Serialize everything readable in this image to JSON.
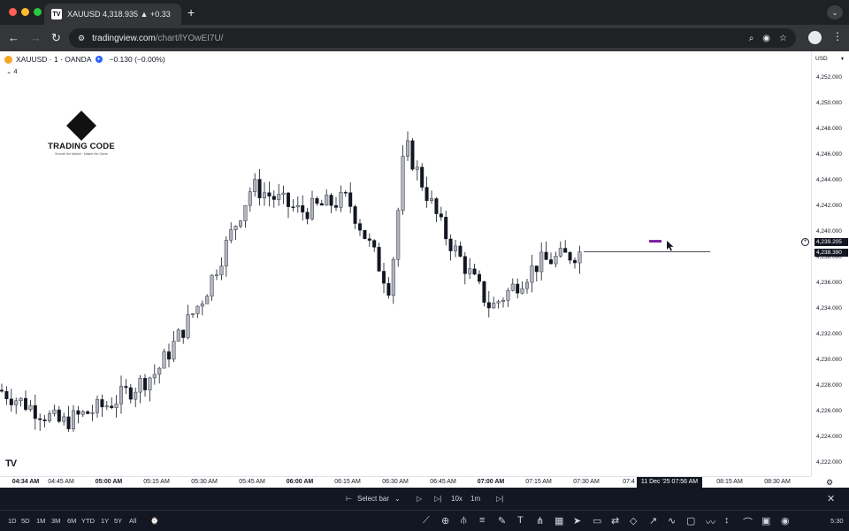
{
  "browser": {
    "tab_title": "XAUUSD 4,318.935 ▲ +0.33",
    "tab_favicon": "tradingview-favicon-icon",
    "url_prefix": "tradingview.com",
    "url_path": "/chart/lYOwEI7U/"
  },
  "chart": {
    "symbol_line": "XAUUSD · 1 · OANDA",
    "change": "−0.130 (−0.00%)",
    "indicator_count": "4",
    "logo_name": "TRADING CODE",
    "logo_tagline": "Smooth the Market · Master the Game",
    "currency": "USD",
    "price_ticks": [
      "4,252.000",
      "4,250.000",
      "4,248.000",
      "4,246.000",
      "4,244.000",
      "4,242.000",
      "4,240.000",
      "4,238.000",
      "4,236.000",
      "4,234.000",
      "4,232.000",
      "4,230.000",
      "4,228.000",
      "4,226.000",
      "4,224.000",
      "4,222.000"
    ],
    "crosshair_price": "4,239.205",
    "last_price": "4,238.390",
    "time_ticks": [
      {
        "label": "04:34 AM",
        "bold": true
      },
      {
        "label": "04:45 AM",
        "bold": false
      },
      {
        "label": "05:00 AM",
        "bold": true
      },
      {
        "label": "05:15 AM",
        "bold": false
      },
      {
        "label": "05:30 AM",
        "bold": false
      },
      {
        "label": "05:45 AM",
        "bold": false
      },
      {
        "label": "06:00 AM",
        "bold": true
      },
      {
        "label": "06:15 AM",
        "bold": false
      },
      {
        "label": "06:30 AM",
        "bold": false
      },
      {
        "label": "06:45 AM",
        "bold": false
      },
      {
        "label": "07:00 AM",
        "bold": true
      },
      {
        "label": "07:15 AM",
        "bold": false
      },
      {
        "label": "07:30 AM",
        "bold": false
      },
      {
        "label": "07:4",
        "bold": false
      },
      {
        "label": "08:15 AM",
        "bold": false
      },
      {
        "label": "08:30 AM",
        "bold": false
      }
    ],
    "crosshair_time": "11 Dec '25   07:56 AM",
    "colors": {
      "up": "#b2b5be",
      "down": "#131722",
      "accent": "#2962ff",
      "highlight": "#7b1fa2"
    }
  },
  "chart_data": {
    "type": "candlestick",
    "symbol": "XAUUSD",
    "interval": "1",
    "exchange": "OANDA",
    "ylim": [
      4221,
      4253
    ],
    "close_path": [
      {
        "x": "04:34 AM",
        "y": 4227.6
      },
      {
        "x": "04:45 AM",
        "y": 4225.0
      },
      {
        "x": "05:00 AM",
        "y": 4226.5
      },
      {
        "x": "05:15 AM",
        "y": 4229.0
      },
      {
        "x": "05:30 AM",
        "y": 4235.0
      },
      {
        "x": "05:45 AM",
        "y": 4243.5
      },
      {
        "x": "06:00 AM",
        "y": 4241.5
      },
      {
        "x": "06:15 AM",
        "y": 4242.5
      },
      {
        "x": "06:30 AM",
        "y": 4235.5
      },
      {
        "x": "06:35 AM",
        "y": 4246.8
      },
      {
        "x": "06:45 AM",
        "y": 4240.0
      },
      {
        "x": "07:00 AM",
        "y": 4234.0
      },
      {
        "x": "07:15 AM",
        "y": 4237.5
      },
      {
        "x": "07:30 AM",
        "y": 4238.4
      }
    ]
  },
  "replay": {
    "select_bar": "Select bar",
    "speed": "10x",
    "interval": "1m"
  },
  "bottom": {
    "timeframes": [
      "1D",
      "5D",
      "1M",
      "3M",
      "6M",
      "YTD",
      "1Y",
      "5Y",
      "All"
    ],
    "clock": "5:30"
  }
}
